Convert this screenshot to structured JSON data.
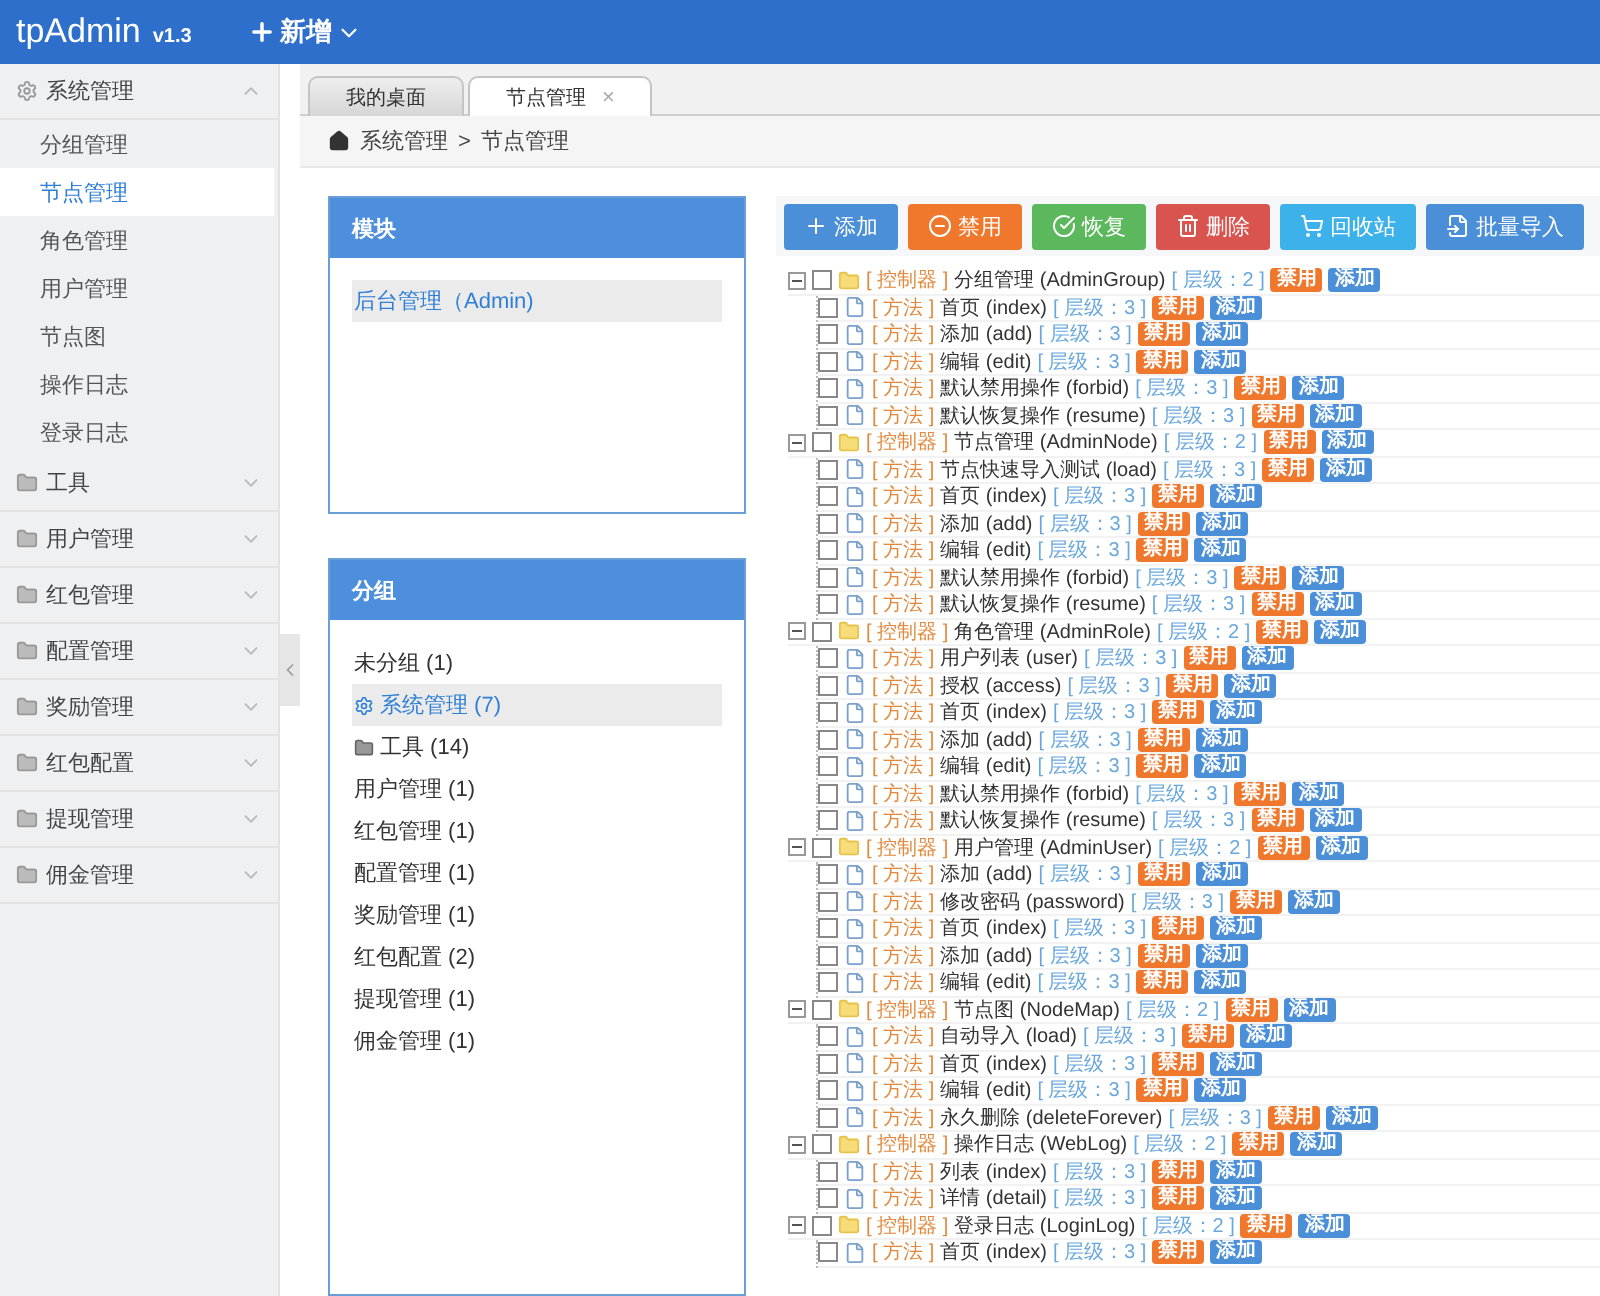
{
  "header": {
    "brand": "tpAdmin",
    "version": "v1.3",
    "new_menu": "新增"
  },
  "sidebar": {
    "menus": [
      {
        "label": "系统管理",
        "kind": "system",
        "expanded": true,
        "children": [
          {
            "label": "分组管理",
            "selected": false
          },
          {
            "label": "节点管理",
            "selected": true
          },
          {
            "label": "角色管理",
            "selected": false
          },
          {
            "label": "用户管理",
            "selected": false
          },
          {
            "label": "节点图",
            "selected": false
          },
          {
            "label": "操作日志",
            "selected": false
          },
          {
            "label": "登录日志",
            "selected": false
          }
        ]
      },
      {
        "label": "工具",
        "kind": "folder",
        "expanded": false
      },
      {
        "label": "用户管理",
        "kind": "folder",
        "expanded": false
      },
      {
        "label": "红包管理",
        "kind": "folder",
        "expanded": false
      },
      {
        "label": "配置管理",
        "kind": "folder",
        "expanded": false
      },
      {
        "label": "奖励管理",
        "kind": "folder",
        "expanded": false
      },
      {
        "label": "红包配置",
        "kind": "folder",
        "expanded": false
      },
      {
        "label": "提现管理",
        "kind": "folder",
        "expanded": false
      },
      {
        "label": "佣金管理",
        "kind": "folder",
        "expanded": false
      }
    ]
  },
  "tabs": [
    {
      "label": "我的桌面",
      "selected": false
    },
    {
      "label": "节点管理",
      "selected": true,
      "close": "×"
    }
  ],
  "breadcrumb": [
    {
      "label": "系统管理"
    },
    {
      "label": ">"
    },
    {
      "label": "节点管理"
    }
  ],
  "module_panel": {
    "title": "模块",
    "items": [
      {
        "label": "后台管理（Admin)",
        "selected": true
      }
    ]
  },
  "group_panel": {
    "title": "分组",
    "items": [
      {
        "label": "未分组 (1)",
        "kind": "plain",
        "selected": false
      },
      {
        "label": "系统管理 (7)",
        "kind": "system",
        "selected": true
      },
      {
        "label": "工具 (14)",
        "kind": "folder",
        "selected": false
      },
      {
        "label": "用户管理 (1)",
        "kind": "plain",
        "selected": false
      },
      {
        "label": "红包管理 (1)",
        "kind": "plain",
        "selected": false
      },
      {
        "label": "配置管理 (1)",
        "kind": "plain",
        "selected": false
      },
      {
        "label": "奖励管理 (1)",
        "kind": "plain",
        "selected": false
      },
      {
        "label": "红包配置 (2)",
        "kind": "plain",
        "selected": false
      },
      {
        "label": "提现管理 (1)",
        "kind": "plain",
        "selected": false
      },
      {
        "label": "佣金管理 (1)",
        "kind": "plain",
        "selected": false
      }
    ]
  },
  "toolbar": [
    {
      "label": "添加",
      "kind": "add",
      "color": "#4a8fd8"
    },
    {
      "label": "禁用",
      "kind": "forbid",
      "color": "#f0782c"
    },
    {
      "label": "恢复",
      "kind": "resume",
      "color": "#5cb85c"
    },
    {
      "label": "删除",
      "kind": "delete",
      "color": "#d9534f"
    },
    {
      "label": "回收站",
      "kind": "recycle",
      "color": "#3db1ea"
    },
    {
      "label": "批量导入",
      "kind": "import",
      "color": "#4a8fd8"
    }
  ],
  "tree": [
    {
      "tag": "[ 控制器 ]",
      "name": "分组管理 (AdminGroup)",
      "level_text": "[ 层级：2 ]",
      "forbid": "禁用",
      "add": "添加",
      "checked": false,
      "expanded": true,
      "children": [
        {
          "tag": "[ 方法 ]",
          "name": "首页 (index)",
          "level_text": "[ 层级：3 ]",
          "forbid": "禁用",
          "add": "添加",
          "checked": false
        },
        {
          "tag": "[ 方法 ]",
          "name": "添加 (add)",
          "level_text": "[ 层级：3 ]",
          "forbid": "禁用",
          "add": "添加",
          "checked": false
        },
        {
          "tag": "[ 方法 ]",
          "name": "编辑 (edit)",
          "level_text": "[ 层级：3 ]",
          "forbid": "禁用",
          "add": "添加",
          "checked": false
        },
        {
          "tag": "[ 方法 ]",
          "name": "默认禁用操作 (forbid)",
          "level_text": "[ 层级：3 ]",
          "forbid": "禁用",
          "add": "添加",
          "checked": false
        },
        {
          "tag": "[ 方法 ]",
          "name": "默认恢复操作 (resume)",
          "level_text": "[ 层级：3 ]",
          "forbid": "禁用",
          "add": "添加",
          "checked": false
        }
      ]
    },
    {
      "tag": "[ 控制器 ]",
      "name": "节点管理 (AdminNode)",
      "level_text": "[ 层级：2 ]",
      "forbid": "禁用",
      "add": "添加",
      "checked": false,
      "expanded": true,
      "children": [
        {
          "tag": "[ 方法 ]",
          "name": "节点快速导入测试 (load)",
          "level_text": "[ 层级：3 ]",
          "forbid": "禁用",
          "add": "添加",
          "checked": false
        },
        {
          "tag": "[ 方法 ]",
          "name": "首页 (index)",
          "level_text": "[ 层级：3 ]",
          "forbid": "禁用",
          "add": "添加",
          "checked": false
        },
        {
          "tag": "[ 方法 ]",
          "name": "添加 (add)",
          "level_text": "[ 层级：3 ]",
          "forbid": "禁用",
          "add": "添加",
          "checked": false
        },
        {
          "tag": "[ 方法 ]",
          "name": "编辑 (edit)",
          "level_text": "[ 层级：3 ]",
          "forbid": "禁用",
          "add": "添加",
          "checked": false
        },
        {
          "tag": "[ 方法 ]",
          "name": "默认禁用操作 (forbid)",
          "level_text": "[ 层级：3 ]",
          "forbid": "禁用",
          "add": "添加",
          "checked": false
        },
        {
          "tag": "[ 方法 ]",
          "name": "默认恢复操作 (resume)",
          "level_text": "[ 层级：3 ]",
          "forbid": "禁用",
          "add": "添加",
          "checked": false
        }
      ]
    },
    {
      "tag": "[ 控制器 ]",
      "name": "角色管理 (AdminRole)",
      "level_text": "[ 层级：2 ]",
      "forbid": "禁用",
      "add": "添加",
      "checked": false,
      "expanded": true,
      "children": [
        {
          "tag": "[ 方法 ]",
          "name": "用户列表 (user)",
          "level_text": "[ 层级：3 ]",
          "forbid": "禁用",
          "add": "添加",
          "checked": false
        },
        {
          "tag": "[ 方法 ]",
          "name": "授权 (access)",
          "level_text": "[ 层级：3 ]",
          "forbid": "禁用",
          "add": "添加",
          "checked": false
        },
        {
          "tag": "[ 方法 ]",
          "name": "首页 (index)",
          "level_text": "[ 层级：3 ]",
          "forbid": "禁用",
          "add": "添加",
          "checked": false
        },
        {
          "tag": "[ 方法 ]",
          "name": "添加 (add)",
          "level_text": "[ 层级：3 ]",
          "forbid": "禁用",
          "add": "添加",
          "checked": false
        },
        {
          "tag": "[ 方法 ]",
          "name": "编辑 (edit)",
          "level_text": "[ 层级：3 ]",
          "forbid": "禁用",
          "add": "添加",
          "checked": false
        },
        {
          "tag": "[ 方法 ]",
          "name": "默认禁用操作 (forbid)",
          "level_text": "[ 层级：3 ]",
          "forbid": "禁用",
          "add": "添加",
          "checked": false
        },
        {
          "tag": "[ 方法 ]",
          "name": "默认恢复操作 (resume)",
          "level_text": "[ 层级：3 ]",
          "forbid": "禁用",
          "add": "添加",
          "checked": false
        }
      ]
    },
    {
      "tag": "[ 控制器 ]",
      "name": "用户管理 (AdminUser)",
      "level_text": "[ 层级：2 ]",
      "forbid": "禁用",
      "add": "添加",
      "checked": false,
      "expanded": true,
      "children": [
        {
          "tag": "[ 方法 ]",
          "name": "添加 (add)",
          "level_text": "[ 层级：3 ]",
          "forbid": "禁用",
          "add": "添加",
          "checked": false
        },
        {
          "tag": "[ 方法 ]",
          "name": "修改密码 (password)",
          "level_text": "[ 层级：3 ]",
          "forbid": "禁用",
          "add": "添加",
          "checked": false
        },
        {
          "tag": "[ 方法 ]",
          "name": "首页 (index)",
          "level_text": "[ 层级：3 ]",
          "forbid": "禁用",
          "add": "添加",
          "checked": false
        },
        {
          "tag": "[ 方法 ]",
          "name": "添加 (add)",
          "level_text": "[ 层级：3 ]",
          "forbid": "禁用",
          "add": "添加",
          "checked": false
        },
        {
          "tag": "[ 方法 ]",
          "name": "编辑 (edit)",
          "level_text": "[ 层级：3 ]",
          "forbid": "禁用",
          "add": "添加",
          "checked": false
        }
      ]
    },
    {
      "tag": "[ 控制器 ]",
      "name": "节点图 (NodeMap)",
      "level_text": "[ 层级：2 ]",
      "forbid": "禁用",
      "add": "添加",
      "checked": false,
      "expanded": true,
      "children": [
        {
          "tag": "[ 方法 ]",
          "name": "自动导入 (load)",
          "level_text": "[ 层级：3 ]",
          "forbid": "禁用",
          "add": "添加",
          "checked": false
        },
        {
          "tag": "[ 方法 ]",
          "name": "首页 (index)",
          "level_text": "[ 层级：3 ]",
          "forbid": "禁用",
          "add": "添加",
          "checked": false
        },
        {
          "tag": "[ 方法 ]",
          "name": "编辑 (edit)",
          "level_text": "[ 层级：3 ]",
          "forbid": "禁用",
          "add": "添加",
          "checked": false
        },
        {
          "tag": "[ 方法 ]",
          "name": "永久删除 (deleteForever)",
          "level_text": "[ 层级：3 ]",
          "forbid": "禁用",
          "add": "添加",
          "checked": false
        }
      ]
    },
    {
      "tag": "[ 控制器 ]",
      "name": "操作日志 (WebLog)",
      "level_text": "[ 层级：2 ]",
      "forbid": "禁用",
      "add": "添加",
      "checked": false,
      "expanded": true,
      "children": [
        {
          "tag": "[ 方法 ]",
          "name": "列表 (index)",
          "level_text": "[ 层级：3 ]",
          "forbid": "禁用",
          "add": "添加",
          "checked": false
        },
        {
          "tag": "[ 方法 ]",
          "name": "详情 (detail)",
          "level_text": "[ 层级：3 ]",
          "forbid": "禁用",
          "add": "添加",
          "checked": false
        }
      ]
    },
    {
      "tag": "[ 控制器 ]",
      "name": "登录日志 (LoginLog)",
      "level_text": "[ 层级：2 ]",
      "forbid": "禁用",
      "add": "添加",
      "checked": false,
      "expanded": true,
      "children": [
        {
          "tag": "[ 方法 ]",
          "name": "首页 (index)",
          "level_text": "[ 层级：3 ]",
          "forbid": "禁用",
          "add": "添加",
          "checked": false
        }
      ]
    }
  ]
}
